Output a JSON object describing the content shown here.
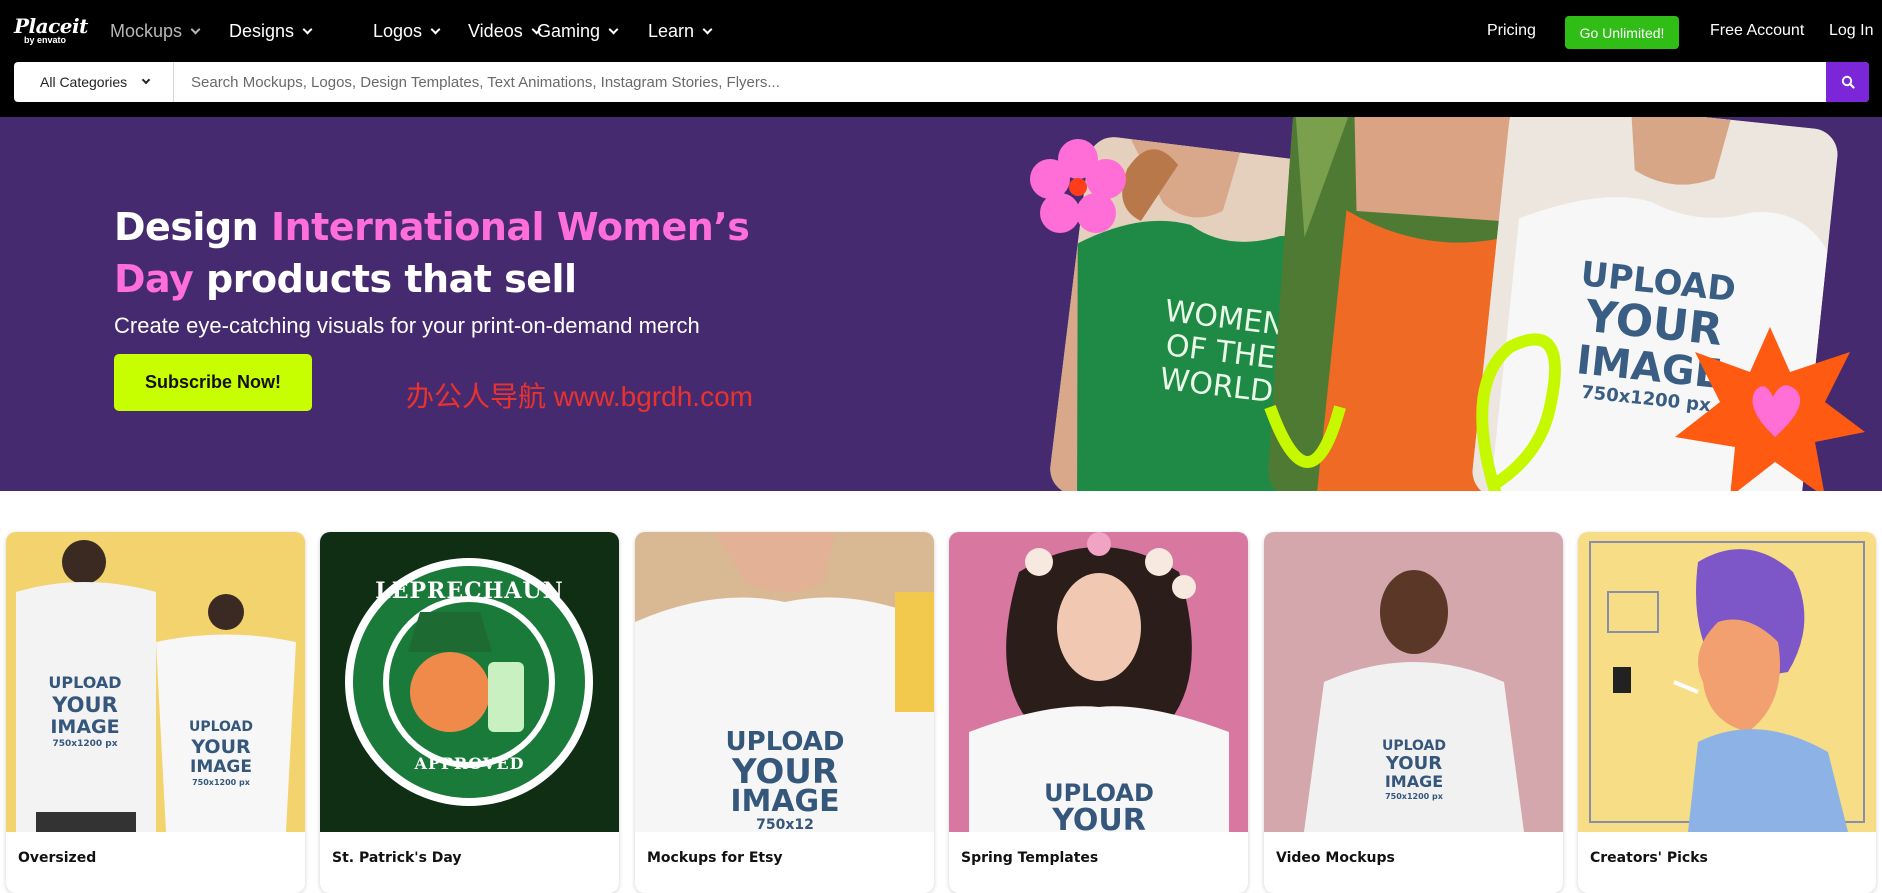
{
  "logo": {
    "main": "Placeit",
    "sub": "by envato"
  },
  "nav": [
    {
      "label": "Mockups"
    },
    {
      "label": "Designs"
    },
    {
      "label": "Logos"
    },
    {
      "label": "Videos"
    },
    {
      "label": "Gaming"
    },
    {
      "label": "Learn"
    }
  ],
  "header_right": {
    "pricing": "Pricing",
    "unlimited": "Go Unlimited!",
    "free_account": "Free Account",
    "login": "Log In"
  },
  "search": {
    "category": "All Categories",
    "placeholder": "Search Mockups, Logos, Design Templates, Text Animations, Instagram Stories, Flyers..."
  },
  "hero": {
    "title_1": "Design ",
    "title_highlight": "International Women’s Day",
    "title_2": " products that sell",
    "subtitle": "Create eye-catching visuals for your print-on-demand merch",
    "cta": "Subscribe Now!",
    "watermark": "办公人导航 www.bgrdh.com",
    "shirt1_text": "WOMEN OF THE WORLD",
    "shirt3_lines": [
      "UPLOAD",
      "YOUR",
      "IMAGE",
      "750x1200 px"
    ]
  },
  "cards": [
    {
      "label": "Oversized",
      "img_text": [
        "UPLOAD",
        "YOUR",
        "IMAGE",
        "750x1200 px"
      ]
    },
    {
      "label": "St. Patrick's Day",
      "img_text": [
        "LEPRECHAUN",
        "APPROVED"
      ]
    },
    {
      "label": "Mockups for Etsy",
      "img_text": [
        "UPLOAD",
        "YOUR",
        "IMAGE",
        "750x12"
      ]
    },
    {
      "label": "Spring  Templates",
      "img_text": [
        "UPLOAD",
        "YOUR"
      ]
    },
    {
      "label": "Video Mockups",
      "img_text": [
        "UPLOAD",
        "YOUR",
        "IMAGE",
        "750x1200 px"
      ]
    },
    {
      "label": "Creators' Picks"
    }
  ],
  "colors": {
    "header_bg": "#000000",
    "hero_bg": "#462a70",
    "accent_pink": "#ff6ed9",
    "cta_lime": "#c8ff00",
    "unlimited_green": "#2fbd16",
    "search_purple": "#7b26d9"
  },
  "icons": {
    "search": "magnifier-icon",
    "dropdown": "chevron-down-icon",
    "flower": "flower-icon",
    "starburst": "starburst-icon",
    "heart": "heart-icon"
  }
}
